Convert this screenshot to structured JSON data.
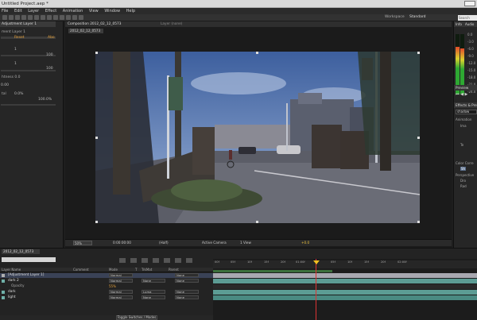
{
  "app": {
    "title": "Untitled Project.aep *"
  },
  "menu": [
    "File",
    "Edit",
    "Layer",
    "Effect",
    "Animation",
    "View",
    "Window",
    "Help"
  ],
  "toolbar": {
    "workspace_label": "Workspace",
    "workspace_value": "Standard",
    "search_placeholder": "Search"
  },
  "effect_controls": {
    "tab": "Adjustment Layer 1",
    "layer_label": "ment Layer 1",
    "reset": "Reset",
    "about": "Abo",
    "v1": "1",
    "v2": "100",
    "v3": "1",
    "v4": "100",
    "v5": "0.00",
    "pct1": "0.0%",
    "pct2": "100.0%",
    "label_a": "tal",
    "label_b": "htness 0.0"
  },
  "composition": {
    "tab_label": "Composition 2012_02_12_0573",
    "layer_tab": "Layer (none)",
    "sub_tab": "2012_02_12_0573",
    "zoom": "50%",
    "timecode": "0:00:00:00",
    "resolution": "(Half)",
    "camera": "Active Camera",
    "views": "1 View",
    "exposure": "+0.0"
  },
  "right_panel": {
    "info_tab": "Info",
    "audio_tab": "Audio",
    "db_labels": [
      "0.0",
      "-3.0",
      "-6.0",
      "-9.0",
      "-12.0",
      "-15.0",
      "-18.0",
      "-21.0",
      "-24.0"
    ],
    "preview_tab": "Preview",
    "effects_tab": "Effects & Pre",
    "search_value": "shadow",
    "anim_presets": "Animation",
    "category1": "Ima",
    "category2": "Te",
    "color_correction": "Color Corre",
    "effect_result": "Sh",
    "perspective": "Perspective",
    "drop_shadow": "Dro",
    "radial": "Rad"
  },
  "timeline": {
    "tab": "2012_02_12_0573",
    "columns": [
      "Layer Name",
      "Comment",
      "Mode",
      "T",
      "TrkMat",
      "Parent"
    ],
    "layers": [
      {
        "name": "[Adjustment Layer 1]",
        "mode": "Normal",
        "matte": "",
        "parent": "None",
        "color": "#b0b0b0"
      },
      {
        "name": "dark 2",
        "mode": "Normal",
        "matte": "None",
        "parent": "None",
        "color": "#6fb0a8"
      },
      {
        "name": "Opacity",
        "mode": "55%",
        "matte": "",
        "parent": "",
        "color": ""
      },
      {
        "name": "dark",
        "mode": "Normal",
        "matte": "Luma",
        "parent": "None",
        "color": "#6fb0a8"
      },
      {
        "name": "light",
        "mode": "Normal",
        "matte": "None",
        "parent": "None",
        "color": "#6fb0a8"
      }
    ],
    "ruler_ticks": [
      "00f",
      "05f",
      "10f",
      "15f",
      "20f",
      "01:00f",
      "05f",
      "10f",
      "15f",
      "20f",
      "02:00f"
    ],
    "toggle": "Toggle Switches / Modes"
  }
}
